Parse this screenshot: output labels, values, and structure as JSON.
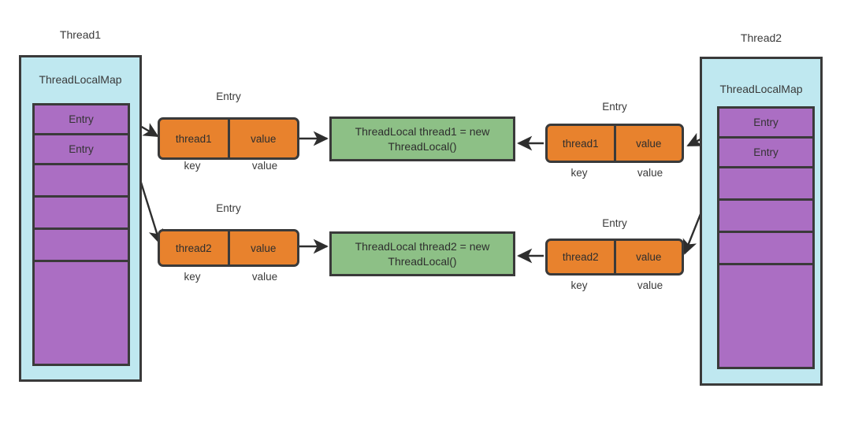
{
  "diagram": {
    "title": "ThreadLocal / ThreadLocalMap relationship",
    "colors": {
      "thread_box": "#bfe8f0",
      "slot": "#ab6ec3",
      "entry": "#e8822d",
      "threadlocal": "#8dc086",
      "stroke": "#3a3a3a",
      "background": "#ffffff"
    }
  },
  "threads": {
    "left": {
      "name": "Thread1",
      "map_label": "ThreadLocalMap",
      "slots": [
        {
          "label": "Entry",
          "filled": true
        },
        {
          "label": "Entry",
          "filled": true
        },
        {
          "label": "",
          "filled": false
        },
        {
          "label": "",
          "filled": false
        },
        {
          "label": "",
          "filled": false
        },
        {
          "label": "",
          "filled": false
        }
      ]
    },
    "right": {
      "name": "Thread2",
      "map_label": "ThreadLocalMap",
      "slots": [
        {
          "label": "Entry",
          "filled": true
        },
        {
          "label": "Entry",
          "filled": true
        },
        {
          "label": "",
          "filled": false
        },
        {
          "label": "",
          "filled": false
        },
        {
          "label": "",
          "filled": false
        },
        {
          "label": "",
          "filled": false
        }
      ]
    }
  },
  "entries": {
    "left_top": {
      "caption": "Entry",
      "key": "thread1",
      "value": "value",
      "key_label": "key",
      "value_label": "value"
    },
    "left_bottom": {
      "caption": "Entry",
      "key": "thread2",
      "value": "value",
      "key_label": "key",
      "value_label": "value"
    },
    "right_top": {
      "caption": "Entry",
      "key": "thread1",
      "value": "value",
      "key_label": "key",
      "value_label": "value"
    },
    "right_bottom": {
      "caption": "Entry",
      "key": "thread2",
      "value": "value",
      "key_label": "key",
      "value_label": "value"
    }
  },
  "threadlocals": {
    "top": {
      "line1": "ThreadLocal thread1 = new",
      "line2": "ThreadLocal()"
    },
    "bottom": {
      "line1": "ThreadLocal thread2 = new",
      "line2": "ThreadLocal()"
    }
  }
}
